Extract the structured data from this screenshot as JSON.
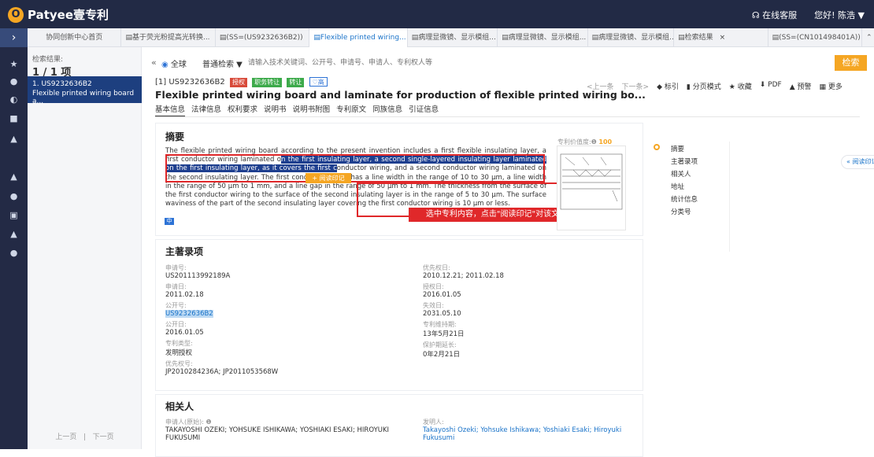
{
  "app": {
    "logo_text": "Patyee壹专利",
    "support": "在线客服",
    "greeting": "您好! 陈浩 ▼"
  },
  "tabs": [
    {
      "label": "协同创新中心首页"
    },
    {
      "label": "基于荧光粉提高光转换..."
    },
    {
      "label": "(SS=(US9232636B2))"
    },
    {
      "label": "Flexible printed wiring..."
    },
    {
      "label": "病理显微镜、显示模组..."
    },
    {
      "label": "病理显微镜、显示模组..."
    },
    {
      "label": "病理显微镜、显示模组..."
    },
    {
      "label": "检索结果"
    },
    {
      "label": "(SS=(CN101498401A))"
    }
  ],
  "sidebar": {
    "result_label": "检索结果:",
    "count": "1 / 1 项",
    "item_id": "1. US9232636B2",
    "item_title": "Flexible printed wiring board a...",
    "prev": "上一页",
    "next": "下一页",
    "separator": "|"
  },
  "search": {
    "scope": "全球",
    "type": "普通检索 ▼",
    "placeholder": "请输入技术关键词、公开号、申请号、申请人、专利权人等",
    "button": "检索"
  },
  "patent": {
    "number": "[1] US9232636B2",
    "badges": [
      {
        "label": "授权",
        "color": "#3daa4b"
      },
      {
        "label": "职务转让",
        "color": "#3daa4b"
      },
      {
        "label": "转让",
        "color": "#3daa4b"
      },
      {
        "label": "高",
        "color": "#2d73d6"
      }
    ],
    "title": "Flexible printed wiring board and laminate for production of flexible printed wiring bo...",
    "tools": [
      "<上一条",
      "下一条>",
      "标引",
      "分页模式",
      "收藏",
      "PDF",
      "预警",
      "更多"
    ],
    "tabs": [
      "基本信息",
      "法律信息",
      "权利要求",
      "说明书",
      "说明书附图",
      "专利原文",
      "同族信息",
      "引证信息"
    ]
  },
  "abstract": {
    "heading": "摘要",
    "text_before": "The flexible printed wiring board according to the present invention includes a first flexible insulating layer, a first conductor wiring laminated o",
    "text_highlight": "n the first insulating layer, a second single-layered insulating layer laminated on the first insulating layer, as it covers the first c",
    "text_after": "onductor wiring, and a second conductor wiring laminated on the second insulating layer. The first conductor wiring has a line width in the range of 10 to 30 μm, a line width in the range of 50 μm to 1 mm, and a line gap in the range of 50 μm to 1 mm. The thickness from the surface of the first conductor wiring to the surface of the second insulating layer is in the range of 5 to 30 μm. The surface waviness of the part of the second insulating layer covering the first conductor wiring is 10 μm or less.",
    "tooltip": "+ 阅读印记",
    "notice": "选中专利内容，点击\"阅读印记\"对该文本进行标记",
    "lang": "中",
    "value_label": "专利价值度:",
    "value": "100"
  },
  "outline": [
    "摘要",
    "主著录项",
    "相关人",
    "地址",
    "统计信息",
    "分类号"
  ],
  "read_mark": "阅读印记",
  "biblio": {
    "heading": "主著录项",
    "left": [
      {
        "label": "申请号:",
        "value": "US201113992189A"
      },
      {
        "label": "申请日:",
        "value": "2011.02.18"
      },
      {
        "label": "公开号:",
        "value": "US9232636B2"
      },
      {
        "label": "公开日:",
        "value": "2016.01.05"
      },
      {
        "label": "专利类型:",
        "value": "发明授权"
      },
      {
        "label": "优先权号:",
        "value": "JP2010284236A; JP2011053568W"
      }
    ],
    "right": [
      {
        "label": "优先权日:",
        "value": "2010.12.21; 2011.02.18"
      },
      {
        "label": "授权日:",
        "value": "2016.01.05"
      },
      {
        "label": "失效日:",
        "value": "2031.05.10"
      },
      {
        "label": "专利维持期:",
        "value": "13年5月21日"
      },
      {
        "label": "保护期延长:",
        "value": "0年2月21日"
      }
    ]
  },
  "people": {
    "heading": "相关人",
    "applicant_label": "申请人(原始):",
    "applicant": "TAKAYOSHI OZEKI; YOHSUKE ISHIKAWA; YOSHIAKI ESAKI; HIROYUKI FUKUSUMI",
    "inventor_label": "发明人:",
    "inventor": "Takayoshi Ozeki; Yohsuke Ishikawa; Yoshiaki Esaki; Hiroyuki Fukusumi"
  },
  "colors": {
    "accent": "#f5a623",
    "nav": "#222a45",
    "highlight": "#1e3f8f",
    "notice": "#e0282a"
  }
}
